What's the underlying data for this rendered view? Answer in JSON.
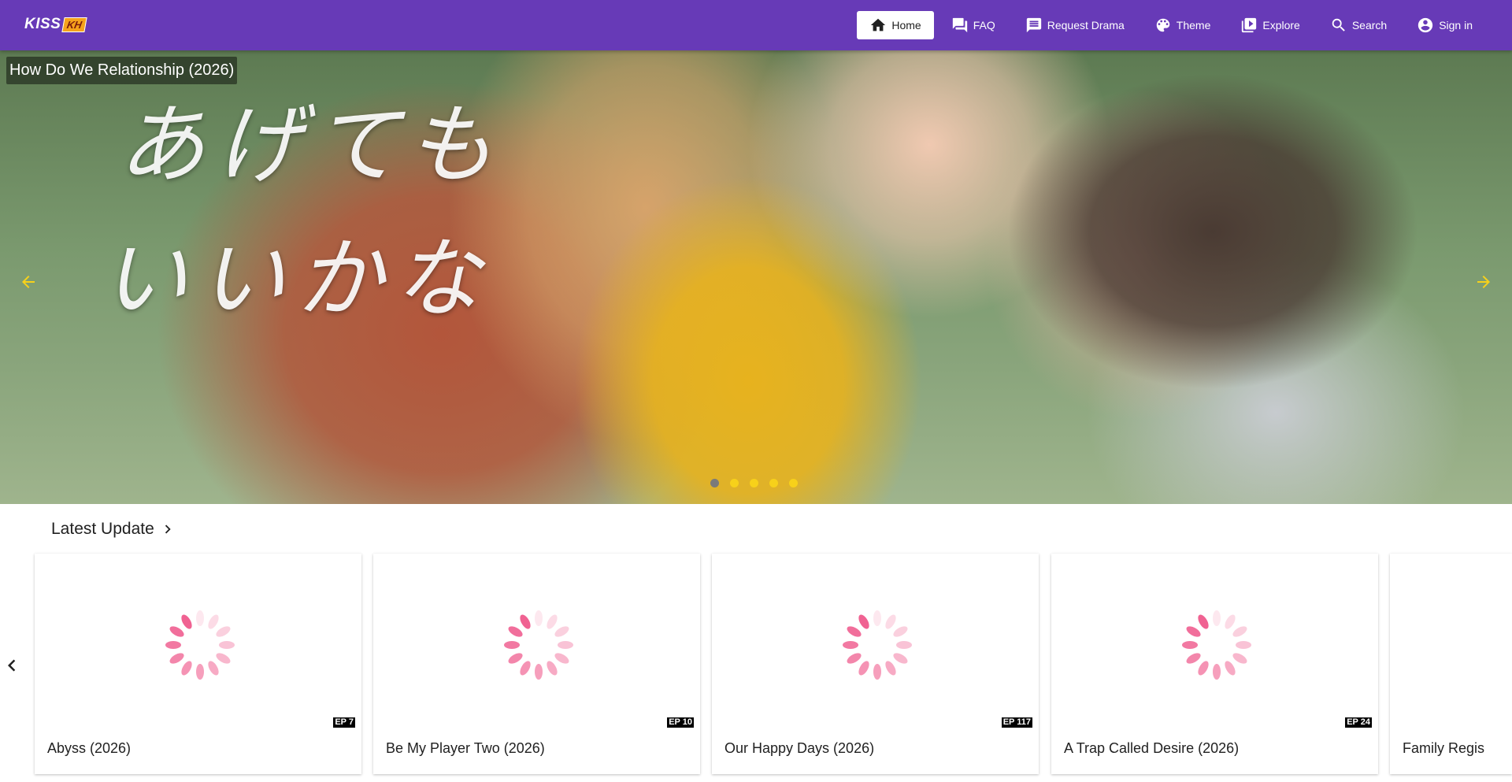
{
  "logo": {
    "text": "KISS",
    "badge": "KH"
  },
  "nav": [
    {
      "label": "Home",
      "icon": "home-icon",
      "active": true
    },
    {
      "label": "FAQ",
      "icon": "forum-icon"
    },
    {
      "label": "Request Drama",
      "icon": "message-icon"
    },
    {
      "label": "Theme",
      "icon": "palette-icon"
    },
    {
      "label": "Explore",
      "icon": "video-library-icon"
    },
    {
      "label": "Search",
      "icon": "search-icon"
    },
    {
      "label": "Sign in",
      "icon": "account-circle-icon"
    }
  ],
  "hero": {
    "title": "How Do We Relationship (2026)",
    "overlay_line1": "あげても",
    "overlay_line2": "いいかな",
    "slide_count": 5,
    "active_slide": 1
  },
  "latest": {
    "heading": "Latest Update",
    "cards": [
      {
        "title": "Abyss (2026)",
        "episode": "EP 7"
      },
      {
        "title": "Be My Player Two (2026)",
        "episode": "EP 10"
      },
      {
        "title": "Our Happy Days (2026)",
        "episode": "EP 117"
      },
      {
        "title": "A Trap Called Desire (2026)",
        "episode": "EP 24"
      },
      {
        "title": "Family Regis"
      }
    ]
  },
  "colors": {
    "primary": "#673ab7",
    "accent": "#f7d11a",
    "spinner": "#f06292"
  }
}
